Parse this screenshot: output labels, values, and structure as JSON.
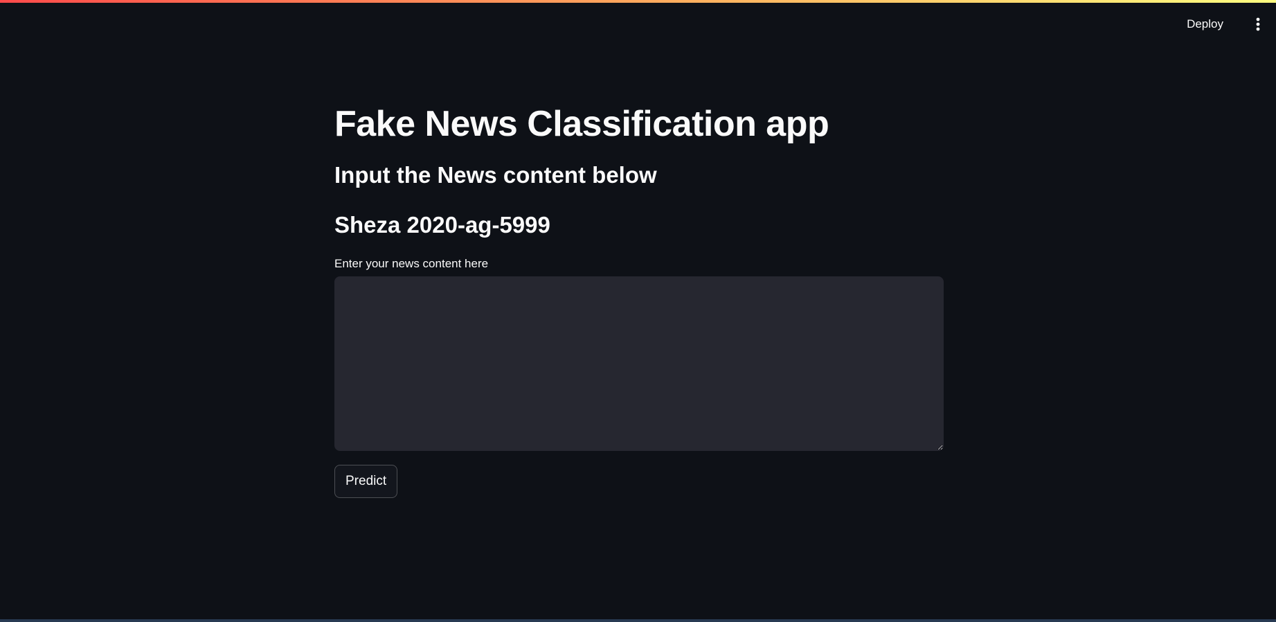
{
  "header": {
    "deploy_label": "Deploy",
    "menu_icon": "more-vertical-icon"
  },
  "main": {
    "title": "Fake News Classification app",
    "subheader_1": "Input the News content below",
    "subheader_2": "Sheza 2020-ag-5999",
    "textarea": {
      "label": "Enter your news content here",
      "value": "",
      "placeholder": ""
    },
    "predict_label": "Predict"
  },
  "colors": {
    "background": "#0e1117",
    "text": "#fafafa",
    "input_background": "#262730",
    "decoration_start": "#ff4b4b",
    "decoration_end": "#fffd80"
  }
}
